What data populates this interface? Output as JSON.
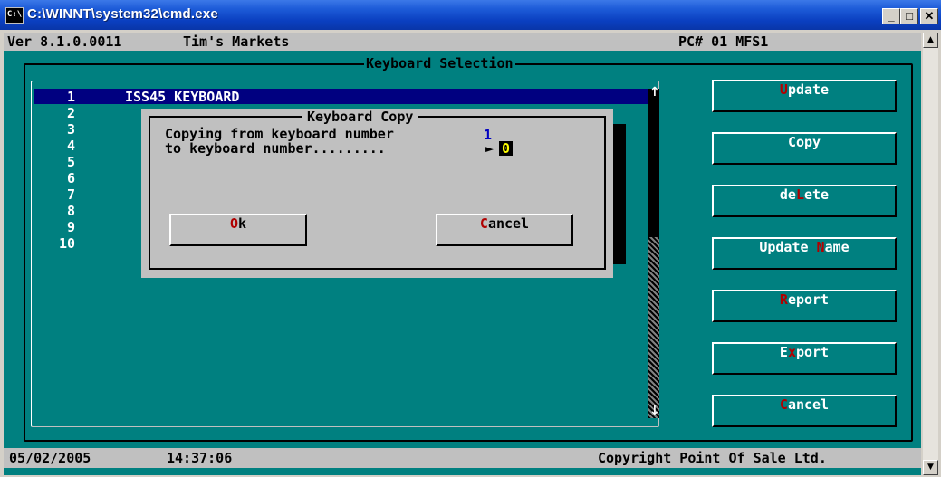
{
  "window": {
    "title": "C:\\WINNT\\system32\\cmd.exe",
    "icon_text": "C:\\",
    "controls": {
      "minimize": "_",
      "maximize": "□",
      "close": "✕"
    }
  },
  "header": {
    "version": "Ver 8.1.0.0011",
    "store": "Tim's Markets",
    "pc": "PC# 01 MFS1"
  },
  "panel": {
    "title": "Keyboard Selection",
    "list": [
      {
        "num": "1",
        "name": "ISS45 KEYBOARD"
      },
      {
        "num": "2",
        "name": ""
      },
      {
        "num": "3",
        "name": ""
      },
      {
        "num": "4",
        "name": ""
      },
      {
        "num": "5",
        "name": ""
      },
      {
        "num": "6",
        "name": ""
      },
      {
        "num": "7",
        "name": ""
      },
      {
        "num": "8",
        "name": ""
      },
      {
        "num": "9",
        "name": ""
      },
      {
        "num": "10",
        "name": ""
      }
    ],
    "scroll_up": "↑",
    "scroll_down": "↓"
  },
  "buttons": [
    {
      "pre": "",
      "hotkey": "U",
      "post": "pdate"
    },
    {
      "pre": "Copy",
      "hotkey": "",
      "post": ""
    },
    {
      "pre": "de",
      "hotkey": "L",
      "post": "ete"
    },
    {
      "pre": "Update ",
      "hotkey": "N",
      "post": "ame"
    },
    {
      "pre": "",
      "hotkey": "R",
      "post": "eport"
    },
    {
      "pre": "E",
      "hotkey": "x",
      "post": "port"
    },
    {
      "pre": "",
      "hotkey": "C",
      "post": "ancel"
    }
  ],
  "dialog": {
    "title": "Keyboard Copy",
    "line1": "Copying from keyboard number",
    "from_value": "1",
    "line2": "to keyboard number.........",
    "pointer": "►",
    "to_value": "0",
    "ok": {
      "pre": "",
      "hotkey": "O",
      "post": "k"
    },
    "cancel": {
      "pre": "",
      "hotkey": "C",
      "post": "ancel"
    }
  },
  "status": {
    "date": "05/02/2005",
    "time": "14:37:06",
    "copyright": "Copyright Point Of Sale Ltd."
  },
  "colors": {
    "console_bg": "#008080",
    "selection": "#000080",
    "hotkey": "#b00000",
    "input_fg": "#ffff00"
  }
}
